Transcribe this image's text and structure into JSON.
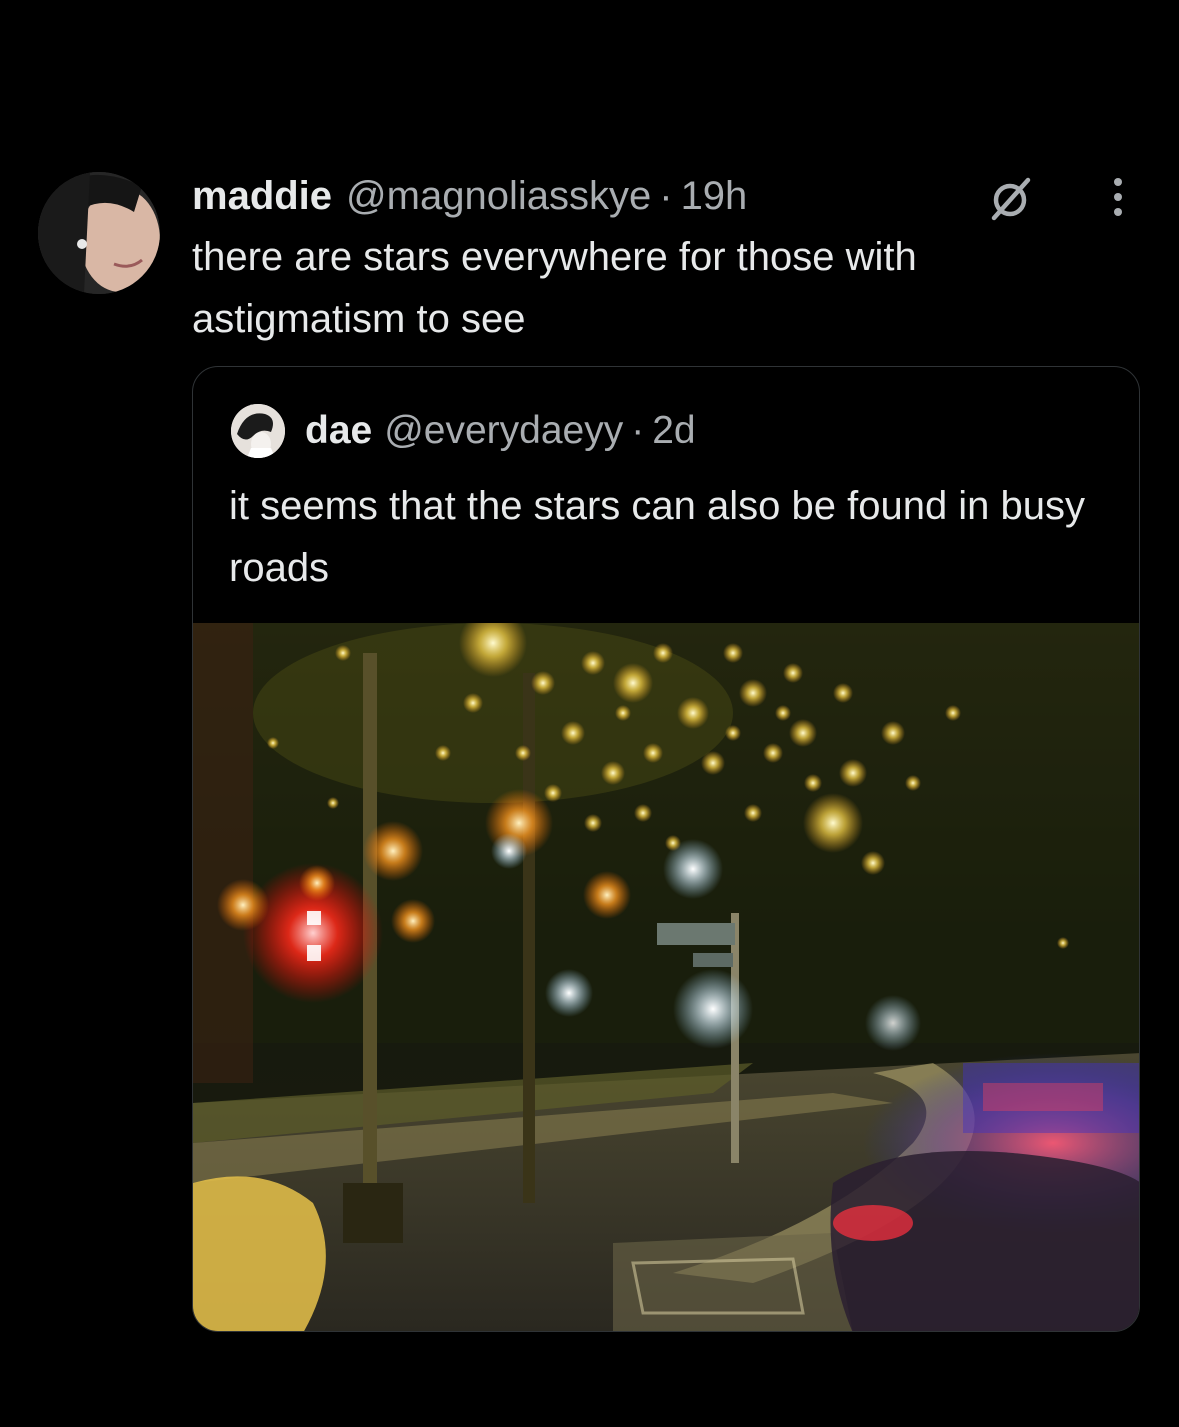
{
  "tweet": {
    "name": "maddie",
    "handle": "@magnoliasskye",
    "separator": "·",
    "time": "19h",
    "text": "there are stars everywhere for those with astigmatism to see",
    "icons": {
      "grok": "grok-icon",
      "more": "more-options-icon"
    }
  },
  "quote": {
    "name": "dae",
    "handle": "@everydaeyy",
    "separator": "·",
    "time": "2d",
    "text": "it seems that the stars can also be found in busy roads"
  }
}
